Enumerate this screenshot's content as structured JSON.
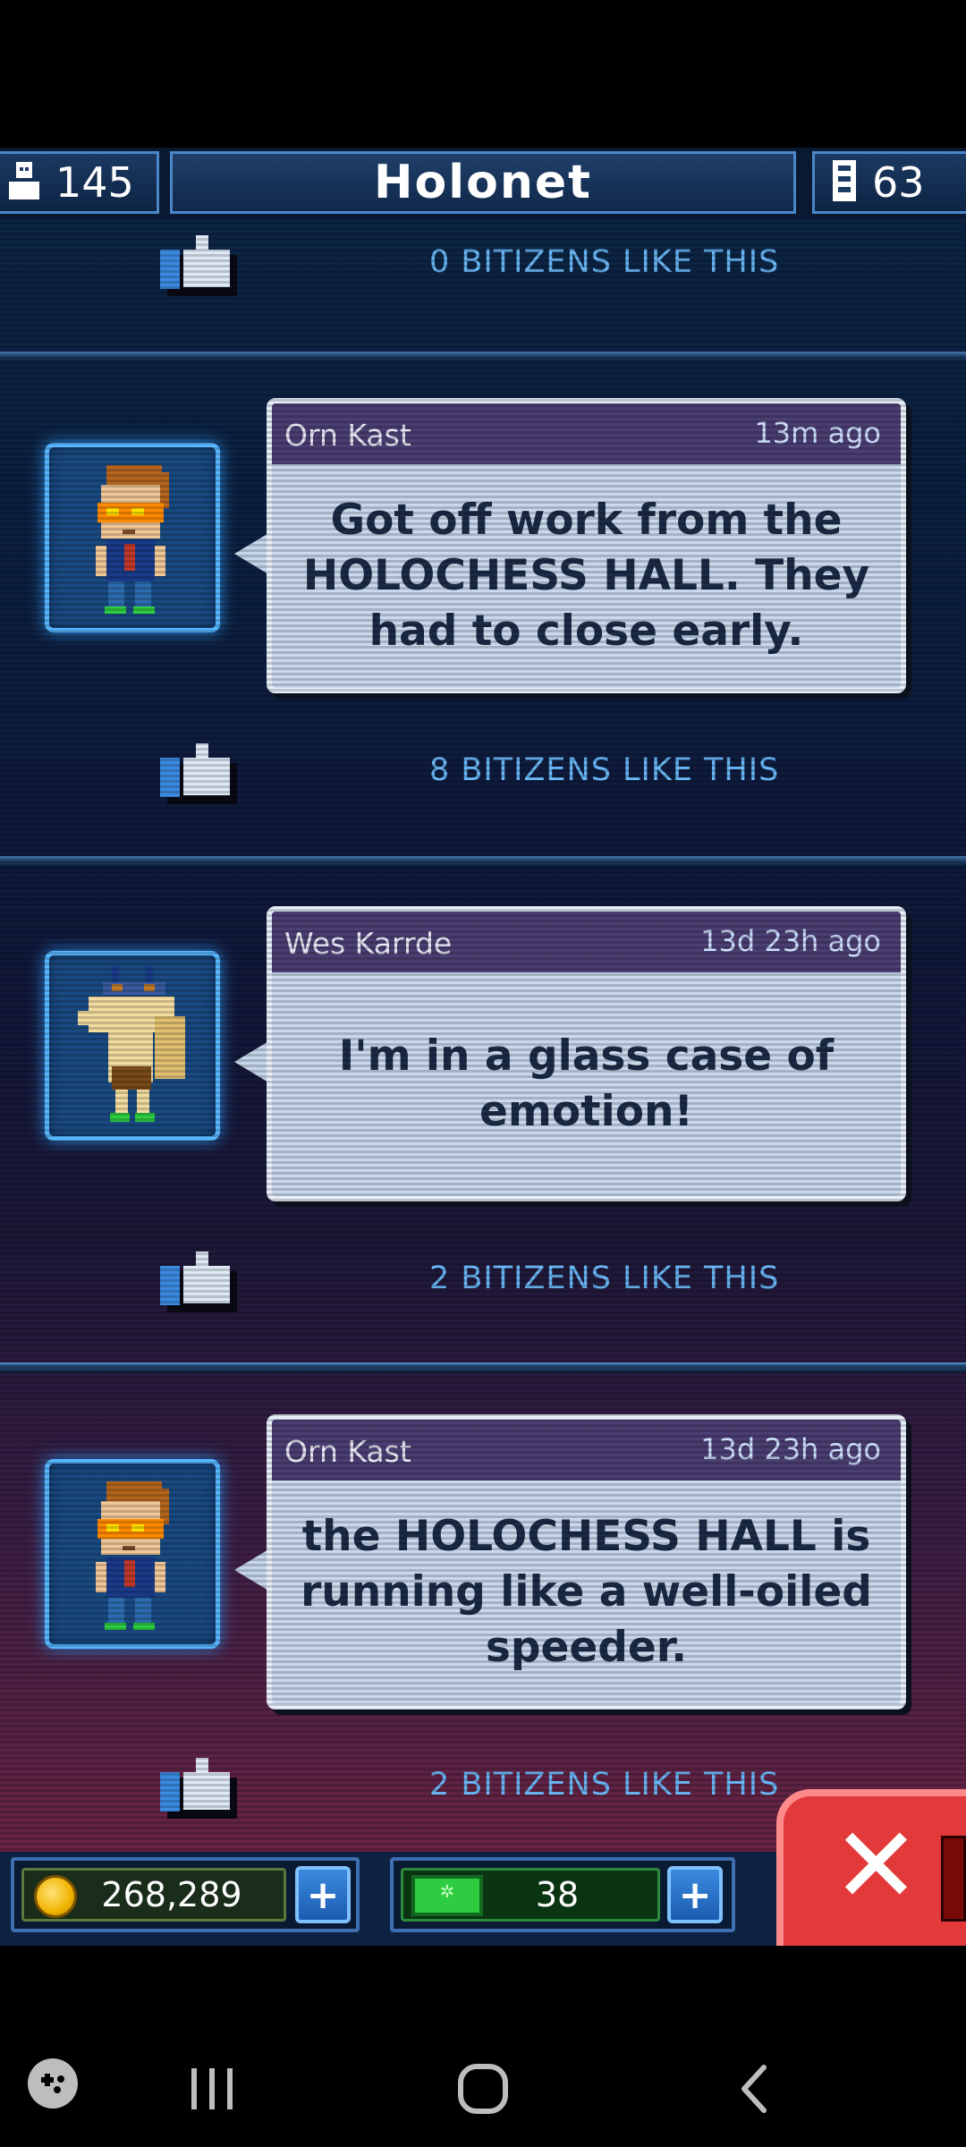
{
  "header": {
    "population": "145",
    "title": "Holonet",
    "floors": "63"
  },
  "feed": {
    "top_like_text": "0 BITIZENS LIKE THIS",
    "posts": [
      {
        "author": "Orn Kast",
        "time": "13m ago",
        "message": "Got off work from the HOLOCHESS HALL. They had to close early.",
        "likes": "8 BITIZENS LIKE THIS"
      },
      {
        "author": "Wes Karrde",
        "time": "13d 23h ago",
        "message": "I'm in a glass case of emotion!",
        "likes": "2 BITIZENS LIKE THIS"
      },
      {
        "author": "Orn Kast",
        "time": "13d 23h ago",
        "message": "the HOLOCHESS HALL is running like a well-oiled speeder.",
        "likes": "2 BITIZENS LIKE THIS"
      }
    ]
  },
  "bottom": {
    "coins": "268,289",
    "bux": "38",
    "plus_label": "+",
    "close_label": "✕"
  },
  "icons": [
    "person-icon",
    "floors-icon",
    "thumbs-up-icon",
    "coin-icon",
    "bux-icon",
    "plus-icon",
    "close-icon",
    "game-launcher-icon",
    "recents-icon",
    "home-icon",
    "back-icon"
  ]
}
